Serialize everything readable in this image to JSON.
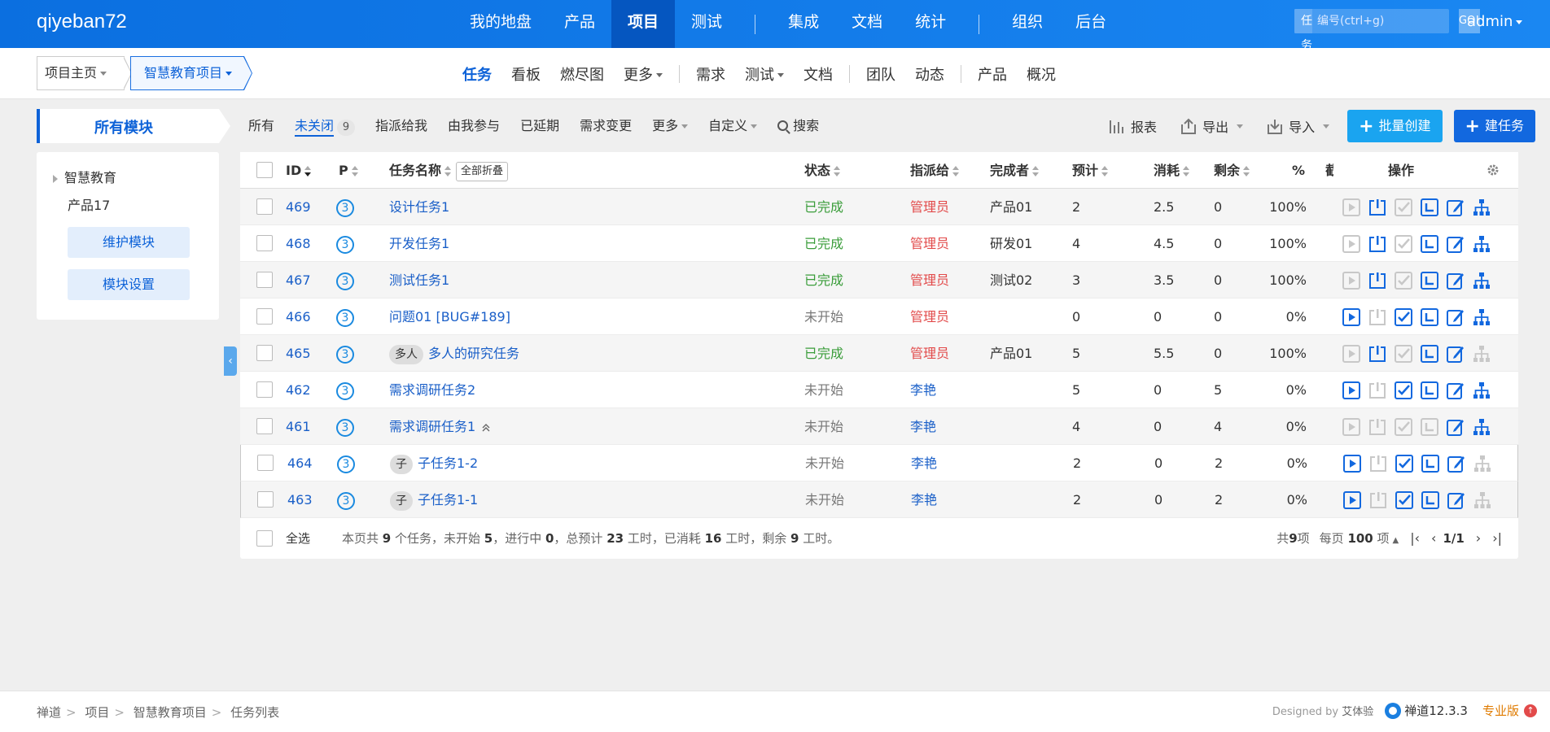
{
  "header": {
    "brand": "qiyeban72",
    "nav": [
      "我的地盘",
      "产品",
      "项目",
      "测试",
      "集成",
      "文档",
      "统计",
      "组织",
      "后台"
    ],
    "nav_active": "项目",
    "search": {
      "type": "任务",
      "placeholder": "编号(ctrl+g)",
      "go": "GO!"
    },
    "user": "admin"
  },
  "subheader": {
    "crumb_home": "项目主页",
    "crumb_project": "智慧教育项目",
    "nav": [
      "任务",
      "看板",
      "燃尽图",
      "更多",
      "需求",
      "测试",
      "文档",
      "团队",
      "动态",
      "产品",
      "概况"
    ],
    "nav_active": "任务"
  },
  "modules": {
    "tab": "所有模块",
    "tree_root": "智慧教育",
    "tree_child": "产品17",
    "maintain": "维护模块",
    "settings": "模块设置"
  },
  "toolbar": {
    "all": "所有",
    "unclosed": "未关闭",
    "unclosed_count": "9",
    "assigned": "指派给我",
    "involved": "由我参与",
    "delayed": "已延期",
    "changed": "需求变更",
    "more": "更多",
    "custom": "自定义",
    "search": "搜索",
    "report": "报表",
    "export": "导出",
    "import": "导入",
    "batch_create": "批量创建",
    "create": "建任务"
  },
  "colors": {
    "accent": "#0d62d8",
    "batch_btn": "#1aa4f0",
    "create_btn": "#1268df",
    "done": "#3a9d3a",
    "assign_red": "#e24a4a"
  },
  "table": {
    "headers": {
      "id": "ID",
      "pri": "P",
      "name": "任务名称",
      "fold": "全部折叠",
      "status": "状态",
      "assigned": "指派给",
      "finished_by": "完成者",
      "estimate": "预计",
      "consumed": "消耗",
      "left": "剩余",
      "progress": "%",
      "extra": "截",
      "actions": "操作"
    },
    "rows": [
      {
        "id": "469",
        "pri": "3",
        "tag": "",
        "name": "设计任务1",
        "status": "已完成",
        "assigned": "管理员",
        "finished_by": "产品01",
        "est": "2",
        "consumed": "2.5",
        "left": "0",
        "pct": "100%"
      },
      {
        "id": "468",
        "pri": "3",
        "tag": "",
        "name": "开发任务1",
        "status": "已完成",
        "assigned": "管理员",
        "finished_by": "研发01",
        "est": "4",
        "consumed": "4.5",
        "left": "0",
        "pct": "100%"
      },
      {
        "id": "467",
        "pri": "3",
        "tag": "",
        "name": "测试任务1",
        "status": "已完成",
        "assigned": "管理员",
        "finished_by": "测试02",
        "est": "3",
        "consumed": "3.5",
        "left": "0",
        "pct": "100%"
      },
      {
        "id": "466",
        "pri": "3",
        "tag": "",
        "name": "问题01 [BUG#189]",
        "status": "未开始",
        "assigned": "管理员",
        "finished_by": "",
        "est": "0",
        "consumed": "0",
        "left": "0",
        "pct": "0%"
      },
      {
        "id": "465",
        "pri": "3",
        "tag": "多人",
        "name": "多人的研究任务",
        "status": "已完成",
        "assigned": "管理员",
        "finished_by": "产品01",
        "est": "5",
        "consumed": "5.5",
        "left": "0",
        "pct": "100%"
      },
      {
        "id": "462",
        "pri": "3",
        "tag": "",
        "name": "需求调研任务2",
        "status": "未开始",
        "assigned": "李艳",
        "finished_by": "",
        "est": "5",
        "consumed": "0",
        "left": "5",
        "pct": "0%"
      },
      {
        "id": "461",
        "pri": "3",
        "tag": "",
        "name": "需求调研任务1",
        "status": "未开始",
        "assigned": "李艳",
        "finished_by": "",
        "est": "4",
        "consumed": "0",
        "left": "4",
        "pct": "0%"
      },
      {
        "id": "464",
        "pri": "3",
        "tag": "子",
        "name": "子任务1-2",
        "status": "未开始",
        "assigned": "李艳",
        "finished_by": "",
        "est": "2",
        "consumed": "0",
        "left": "2",
        "pct": "0%"
      },
      {
        "id": "463",
        "pri": "3",
        "tag": "子",
        "name": "子任务1-1",
        "status": "未开始",
        "assigned": "李艳",
        "finished_by": "",
        "est": "2",
        "consumed": "0",
        "left": "2",
        "pct": "0%"
      }
    ],
    "footer": {
      "select_all": "全选",
      "s1": "本页共 ",
      "count": "9",
      "s2": " 个任务，未开始 ",
      "wait": "5",
      "s3": "，进行中 ",
      "doing": "0",
      "s4": "，总预计 ",
      "est": "23",
      "s5": " 工时，已消耗 ",
      "consumed": "16",
      "s6": " 工时，剩余 ",
      "left": "9",
      "s7": " 工时。",
      "total_pre": "共 ",
      "total": "9",
      "total_post": " 项",
      "per_pre": "每页 ",
      "per": "100",
      "per_post": " 项",
      "page": "1/1"
    }
  },
  "bottom": {
    "crumbs": [
      "禅道",
      "项目",
      "智慧教育项目",
      "任务列表"
    ],
    "designed_by": "Designed by",
    "designer": "艾体验",
    "version": "禅道12.3.3",
    "edition": "专业版"
  }
}
